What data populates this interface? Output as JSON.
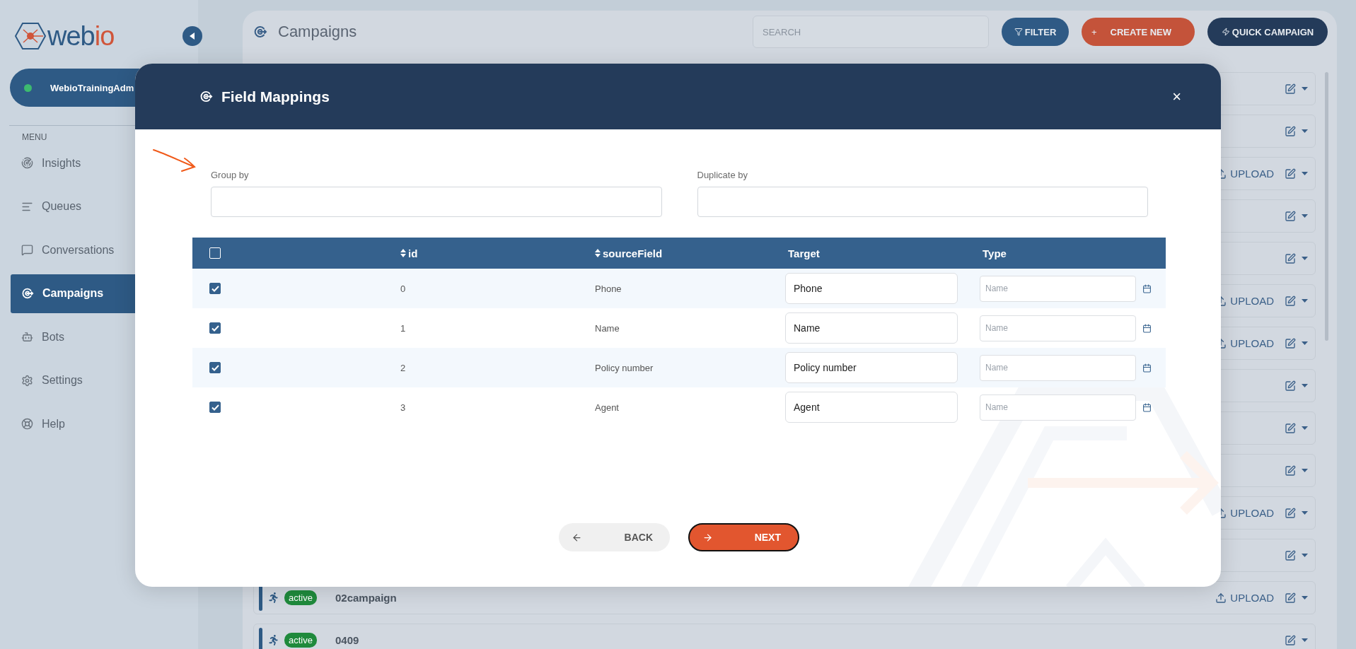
{
  "logo": {
    "main": "web",
    "accent": "io"
  },
  "sidebar": {
    "user": {
      "name": "WebioTrainingAdm",
      "online": true
    },
    "menu_label": "MENU",
    "items": [
      {
        "label": "Insights",
        "selected": false
      },
      {
        "label": "Queues",
        "selected": false
      },
      {
        "label": "Conversations",
        "selected": false
      },
      {
        "label": "Campaigns",
        "selected": true
      },
      {
        "label": "Bots",
        "selected": false
      },
      {
        "label": "Settings",
        "selected": false
      },
      {
        "label": "Help",
        "selected": false
      }
    ]
  },
  "page": {
    "title": "Campaigns",
    "search": {
      "placeholder": "SEARCH"
    },
    "buttons": [
      {
        "kind": "filter",
        "label": "FILTER"
      },
      {
        "kind": "create",
        "label": "CREATE NEW",
        "icon_text": "+"
      },
      {
        "kind": "quick",
        "label": "QUICK CAMPAIGN"
      }
    ]
  },
  "campaigns": [
    {
      "kind": "covered"
    },
    {
      "kind": "covered"
    },
    {
      "kind": "covered",
      "upload_label": "UPLOAD"
    },
    {
      "kind": "covered"
    },
    {
      "kind": "covered"
    },
    {
      "kind": "covered",
      "upload_label": "UPLOAD"
    },
    {
      "kind": "covered",
      "upload_label": "UPLOAD"
    },
    {
      "kind": "covered"
    },
    {
      "kind": "covered"
    },
    {
      "kind": "covered"
    },
    {
      "kind": "covered",
      "upload_label": "UPLOAD"
    },
    {
      "kind": "covered"
    },
    {
      "kind": "full",
      "badge": "active",
      "name": "02campaign",
      "upload_label": "UPLOAD"
    },
    {
      "kind": "full",
      "badge": "active",
      "name": "0409"
    }
  ],
  "modal": {
    "title": "Field Mappings",
    "close": "×",
    "fields": [
      {
        "label": "Group by"
      },
      {
        "label": "Duplicate by"
      }
    ],
    "table": {
      "all_checked": false,
      "columns": [
        {
          "label": "id",
          "sortable": true
        },
        {
          "label": "sourceField",
          "sortable": true
        },
        {
          "label": "Target",
          "sortable": false
        },
        {
          "label": "Type",
          "sortable": false
        }
      ],
      "rows": [
        {
          "checked": true,
          "id": "0",
          "source_field": "Phone",
          "target": "Phone",
          "type_placeholder": "Name"
        },
        {
          "checked": true,
          "id": "1",
          "source_field": "Name",
          "target": "Name",
          "type_placeholder": "Name"
        },
        {
          "checked": true,
          "id": "2",
          "source_field": "Policy number",
          "target": "Policy number",
          "type_placeholder": "Name"
        },
        {
          "checked": true,
          "id": "3",
          "source_field": "Agent",
          "target": "Agent",
          "type_placeholder": "Name"
        }
      ]
    },
    "buttons": [
      {
        "kind": "back",
        "label": "BACK"
      },
      {
        "kind": "next",
        "label": "NEXT"
      }
    ]
  }
}
